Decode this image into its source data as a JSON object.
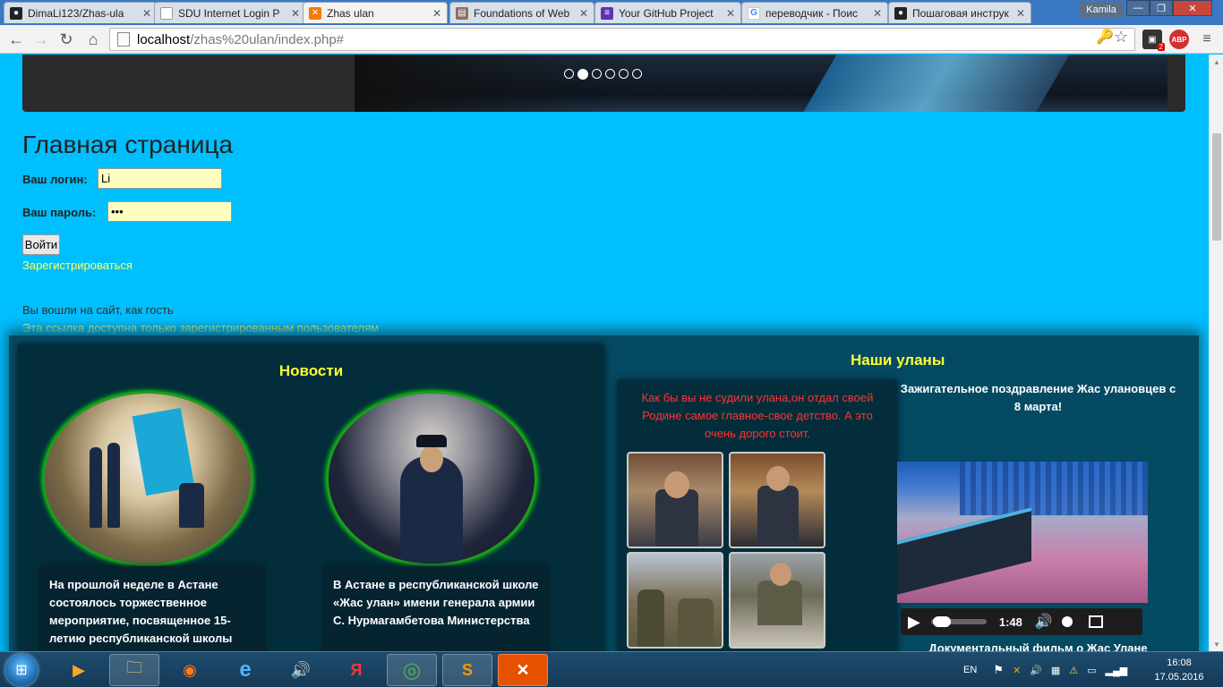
{
  "browser": {
    "tabs": [
      {
        "title": "DimaLi123/Zhas-ula",
        "favicon": "github-icon",
        "color": "#222222"
      },
      {
        "title": "SDU Internet Login P",
        "favicon": "page-icon",
        "color": "#888888"
      },
      {
        "title": "Zhas ulan",
        "favicon": "xampp-icon",
        "color": "#f57c00",
        "active": true
      },
      {
        "title": "Foundations of Web",
        "favicon": "book-icon",
        "color": "#8d6e63"
      },
      {
        "title": "Your GitHub Project",
        "favicon": "list-icon",
        "color": "#5e35b1"
      },
      {
        "title": "переводчик - Поис",
        "favicon": "google-icon",
        "color": "#4285f4"
      },
      {
        "title": "Пошаговая инструк",
        "favicon": "github-icon",
        "color": "#222222"
      }
    ],
    "user": "Kamila",
    "url_host": "localhost",
    "url_path": "/zhas%20ulan/index.php#",
    "ext_badge": "2",
    "abp_label": "ABP"
  },
  "slider": {
    "dot_count": 6,
    "active_dot": 2
  },
  "page": {
    "title": "Главная страница",
    "login_label": "Ваш логин:",
    "login_value": "Li",
    "password_label": "Ваш пароль:",
    "password_value": "•••",
    "login_button": "Войти",
    "register_link": "Зарегистрироваться",
    "guest_text": "Вы вошли на сайт, как гость",
    "members_link": "Эта ссылка доступна только зарегистрированным пользователям"
  },
  "news": {
    "title": "Новости",
    "items": [
      {
        "text": "На прошлой неделе в Астане состоялось торжественное мероприятие, посвященное 15-летию республиканской школы"
      },
      {
        "text": "В Астане в республиканской школе «Жас улан» имени генерала армии С. Нурмагамбетова Министерства"
      }
    ]
  },
  "ulans": {
    "title": "Наши уланы",
    "quote": "Как бы вы не судили улана,он отдал своей Родине самое главное-свое детство. А это очень дорого стоит.",
    "video_title": "Зажигательное поздравление Жас улановцев с 8 марта!",
    "video_time": "1:48",
    "video_progress": 0.06,
    "doc_title": "Документальный фильм о Жас Улане"
  },
  "taskbar": {
    "apps": [
      {
        "name": "media-player-icon",
        "glyph": "▶"
      },
      {
        "name": "explorer-icon",
        "glyph": "🗀"
      },
      {
        "name": "firefox-icon",
        "glyph": "◉"
      },
      {
        "name": "ie-icon",
        "glyph": "e"
      },
      {
        "name": "audio-icon",
        "glyph": "🔊"
      },
      {
        "name": "yandex-icon",
        "glyph": "Я"
      },
      {
        "name": "chrome-icon",
        "glyph": "◎"
      },
      {
        "name": "sublime-icon",
        "glyph": "S"
      },
      {
        "name": "xampp-icon",
        "glyph": "✕"
      }
    ],
    "lang": "EN",
    "time": "16:08",
    "date": "17.05.2016"
  },
  "colors": {
    "page_bg": "#00bfff",
    "accent_yellow": "#ffff33",
    "quote_red": "#ff3333",
    "panel": "#054a63"
  }
}
